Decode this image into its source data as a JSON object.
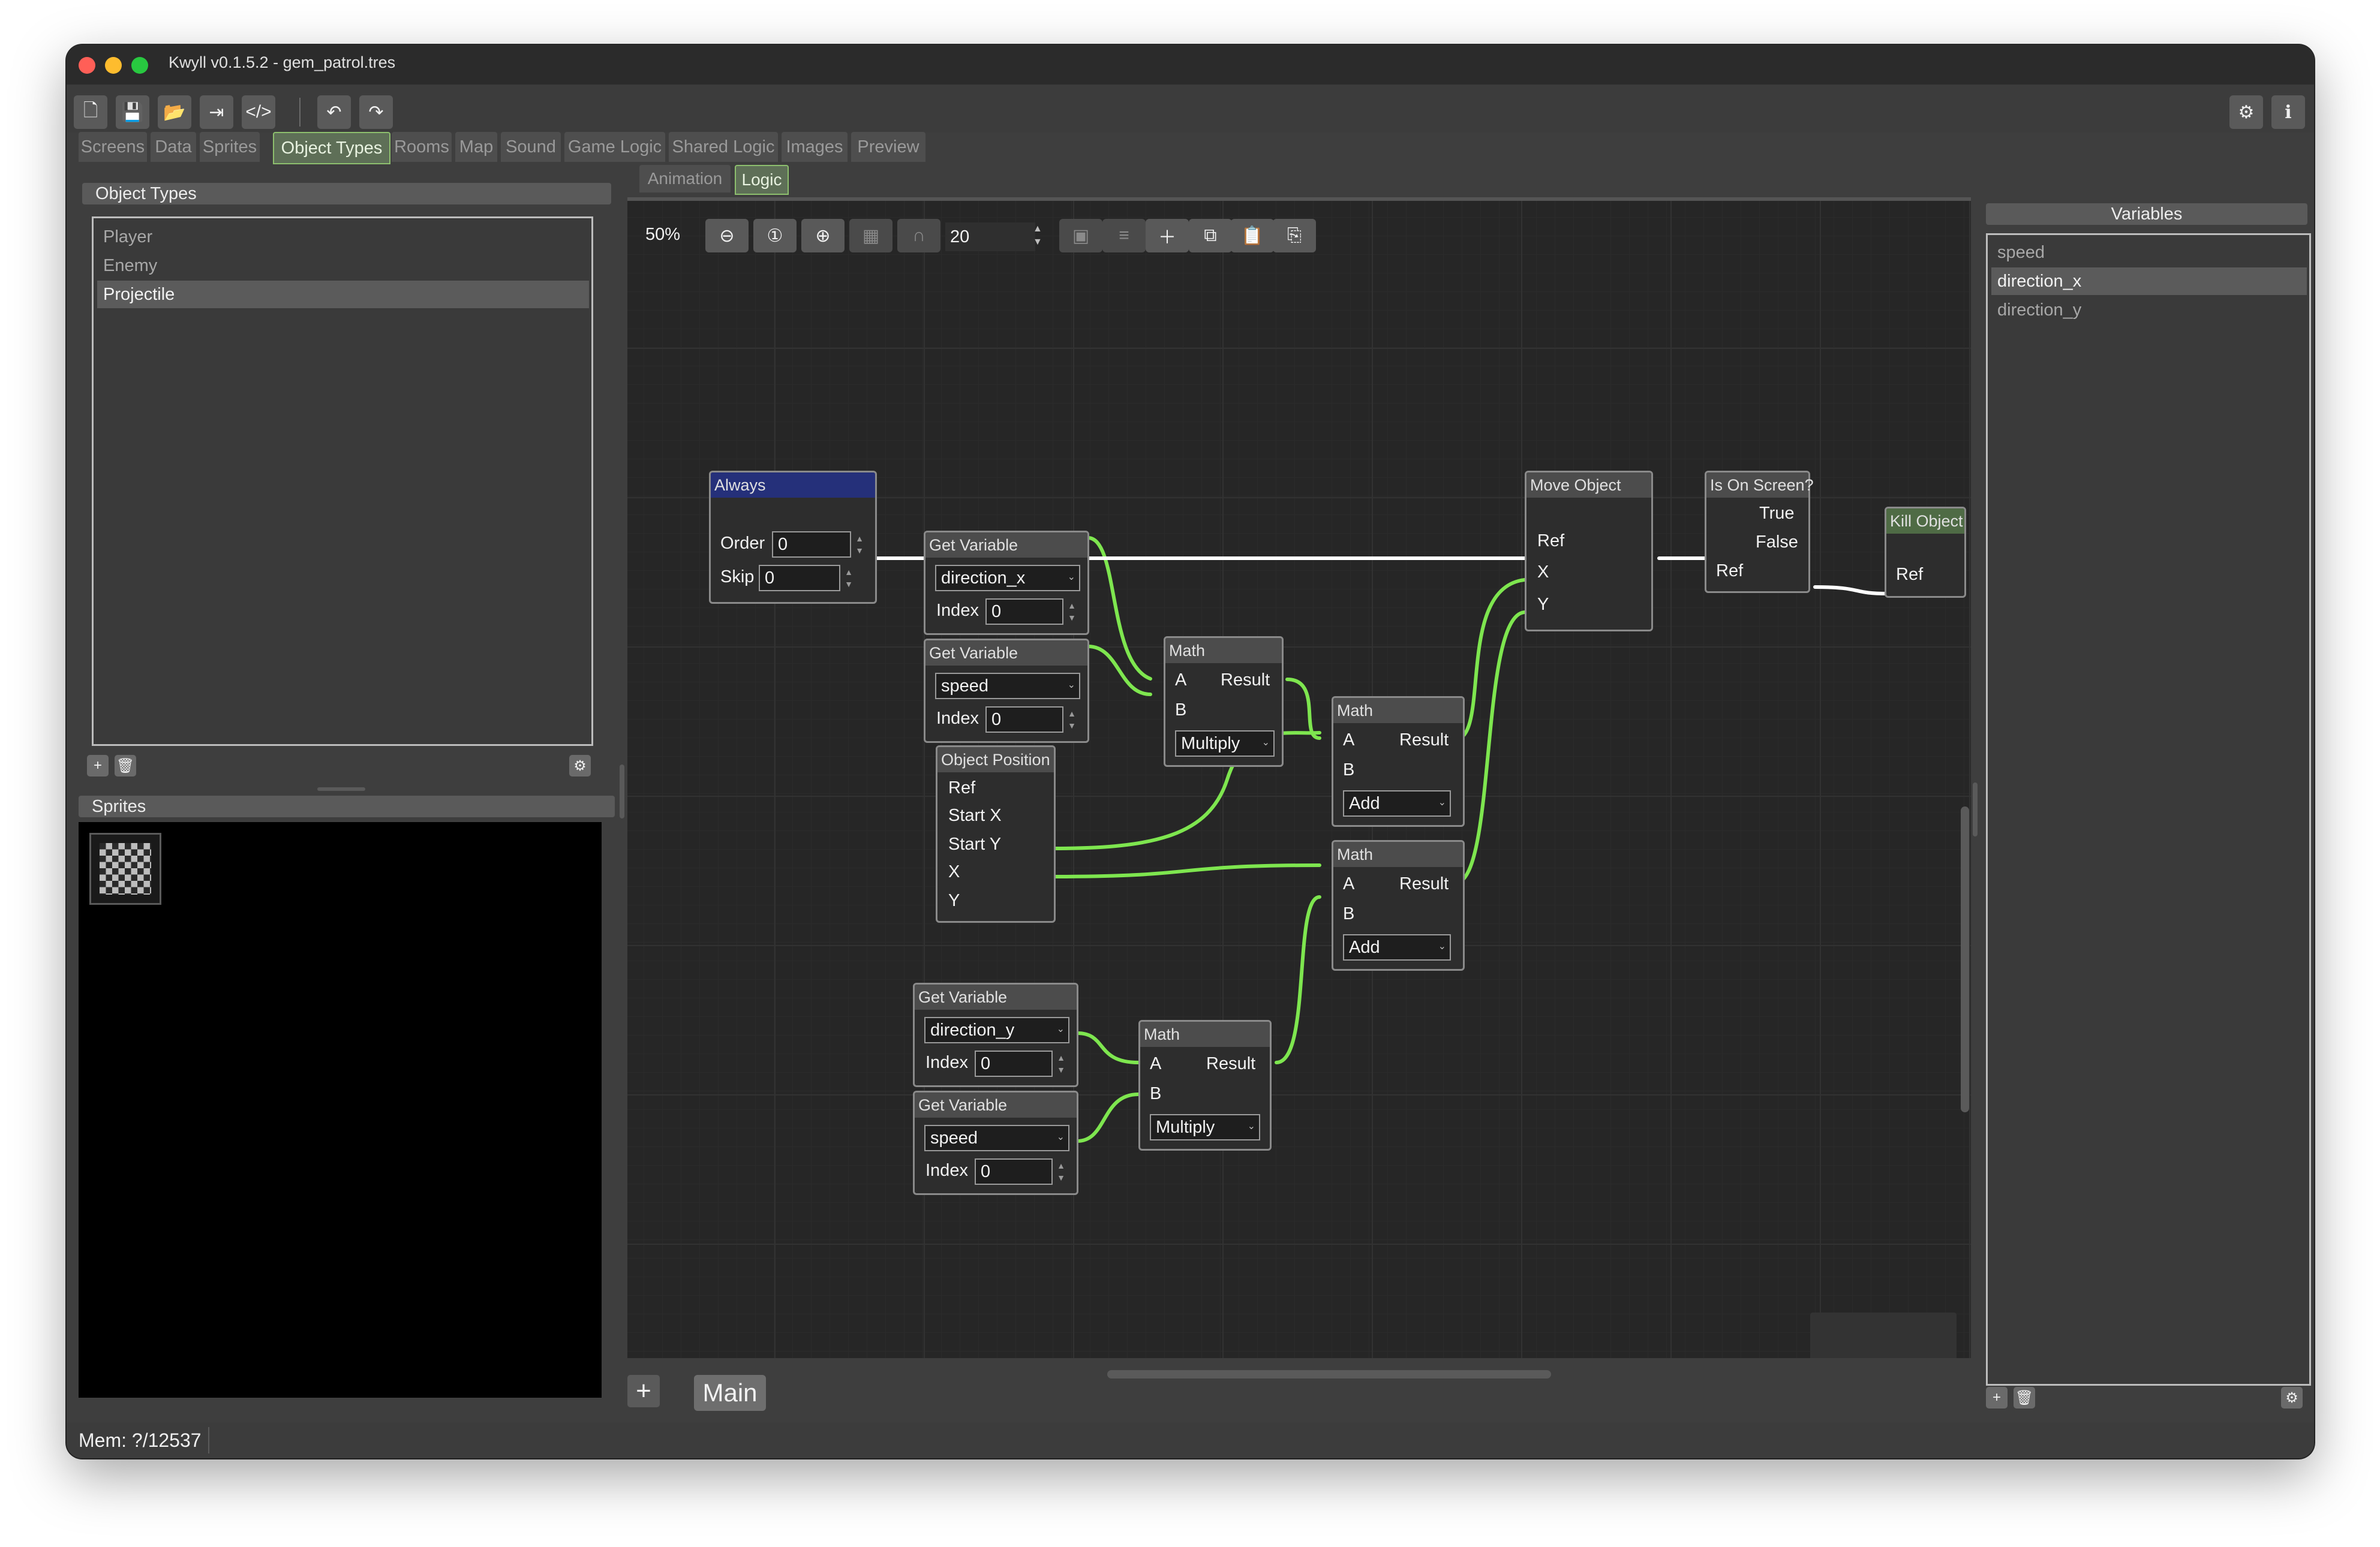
{
  "window": {
    "title": "Kwyll v0.1.5.2 - gem_patrol.tres",
    "traffic": {
      "close": "#ff5f57",
      "minimize": "#febc2e",
      "zoom": "#28c840"
    }
  },
  "toolbar": {
    "icons": [
      "new-file-icon",
      "save-icon",
      "open-folder-icon",
      "export-icon",
      "code-icon",
      "undo-icon",
      "redo-icon",
      "settings-icon",
      "info-icon"
    ]
  },
  "main_tabs": [
    {
      "label": "Screens"
    },
    {
      "label": "Data"
    },
    {
      "label": "Sprites"
    },
    {
      "label": "Object Types"
    },
    {
      "label": "Rooms"
    },
    {
      "label": "Map"
    },
    {
      "label": "Sound"
    },
    {
      "label": "Game Logic"
    },
    {
      "label": "Shared Logic"
    },
    {
      "label": "Images"
    },
    {
      "label": "Preview"
    }
  ],
  "active_main_tab": "Object Types",
  "object_types": {
    "header": "Object Types",
    "items": [
      {
        "label": "Player"
      },
      {
        "label": "Enemy"
      },
      {
        "label": "Projectile"
      }
    ],
    "selected": "Projectile"
  },
  "sprites": {
    "header": "Sprites"
  },
  "sub_tabs": [
    {
      "label": "Animation"
    },
    {
      "label": "Logic"
    }
  ],
  "graph_toolbar": {
    "zoom": "50%",
    "snap": "20"
  },
  "nodes": {
    "always": {
      "title": "Always",
      "order_label": "Order",
      "order_value": "0",
      "skip_label": "Skip",
      "skip_value": "0"
    },
    "get1": {
      "title": "Get Variable",
      "var": "direction_x",
      "index_label": "Index",
      "index_value": "0"
    },
    "get2": {
      "title": "Get Variable",
      "var": "speed",
      "index_label": "Index",
      "index_value": "0"
    },
    "objpos": {
      "title": "Object Position",
      "ref": "Ref",
      "startx": "Start X",
      "starty": "Start Y",
      "x": "X",
      "y": "Y"
    },
    "get3": {
      "title": "Get Variable",
      "var": "direction_y",
      "index_label": "Index",
      "index_value": "0"
    },
    "get4": {
      "title": "Get Variable",
      "var": "speed",
      "index_label": "Index",
      "index_value": "0"
    },
    "math1": {
      "title": "Math",
      "a": "A",
      "b": "B",
      "result": "Result",
      "op": "Multiply"
    },
    "math2": {
      "title": "Math",
      "a": "A",
      "b": "B",
      "result": "Result",
      "op": "Add"
    },
    "math3": {
      "title": "Math",
      "a": "A",
      "b": "B",
      "result": "Result",
      "op": "Add"
    },
    "math4": {
      "title": "Math",
      "a": "A",
      "b": "B",
      "result": "Result",
      "op": "Multiply"
    },
    "move": {
      "title": "Move Object",
      "ref": "Ref",
      "x": "X",
      "y": "Y"
    },
    "onscreen": {
      "title": "Is On Screen?",
      "true": "True",
      "false": "False",
      "ref": "Ref"
    },
    "kill": {
      "title": "Kill Object",
      "ref": "Ref"
    }
  },
  "graph_tabs": {
    "add": "+",
    "main": "Main"
  },
  "variables": {
    "header": "Variables",
    "items": [
      {
        "label": "speed"
      },
      {
        "label": "direction_x"
      },
      {
        "label": "direction_y"
      }
    ],
    "selected": "direction_x"
  },
  "status": {
    "mem": "Mem: ?/12537"
  },
  "colors": {
    "wire": "#7ee64f",
    "exec": "#ffffff",
    "always_title": "#25307a",
    "kill_title": "#4f6b45"
  }
}
